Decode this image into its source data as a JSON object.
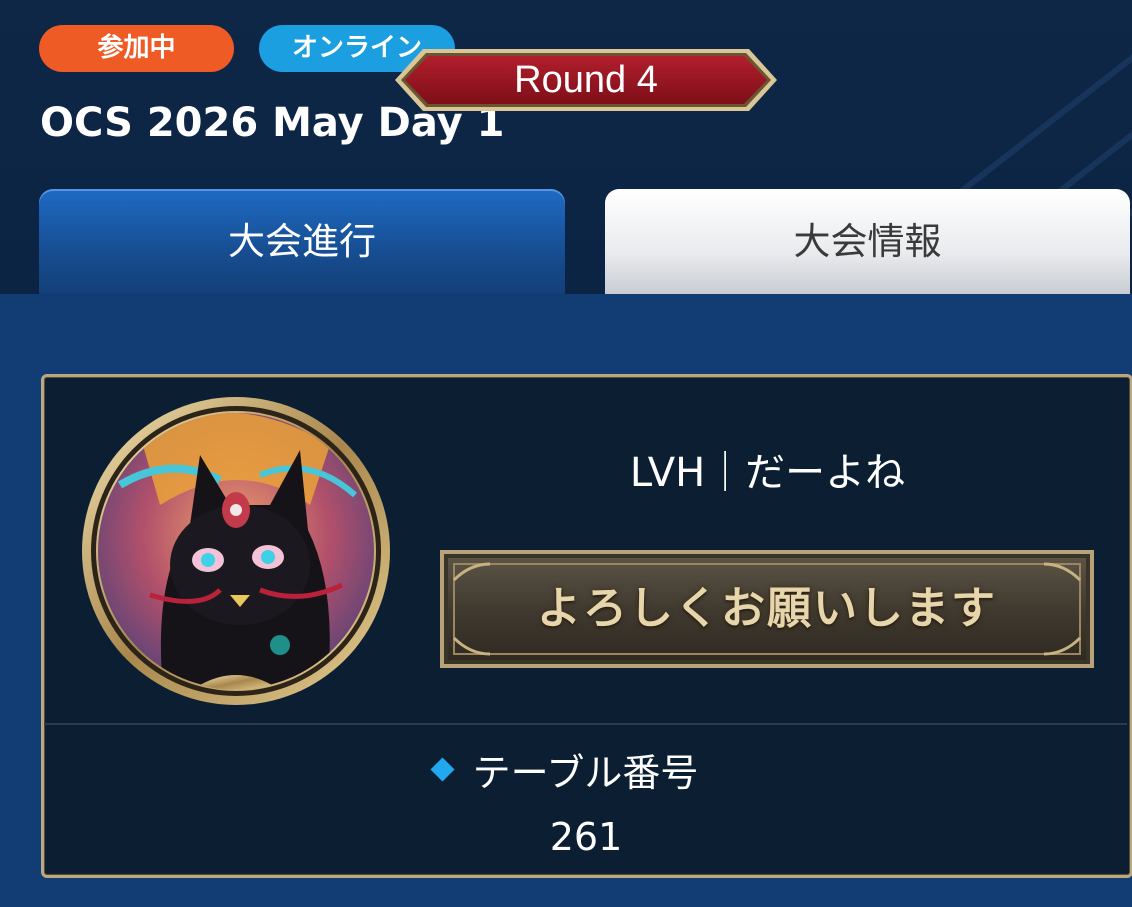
{
  "header": {
    "status_badge": "参加中",
    "online_badge": "オンライン",
    "event_title": "OCS 2026 May Day 1"
  },
  "tabs": [
    {
      "label": "大会進行",
      "active": true
    },
    {
      "label": "大会情報",
      "active": false
    }
  ],
  "match": {
    "round_label": "Round 4",
    "player_name": "LVH｜だーよね",
    "greeting_stamp": "よろしくお願いします",
    "table_heading": "テーブル番号",
    "table_number": "261"
  },
  "colors": {
    "status_badge": "#ee5b25",
    "online_badge": "#1c9fe0",
    "round_banner": "#9b1723",
    "card_border": "#bca880",
    "accent_diamond": "#21a8ee"
  },
  "icons": {
    "avatar": "black-cat-avatar-icon",
    "table_marker": "diamond-icon"
  }
}
